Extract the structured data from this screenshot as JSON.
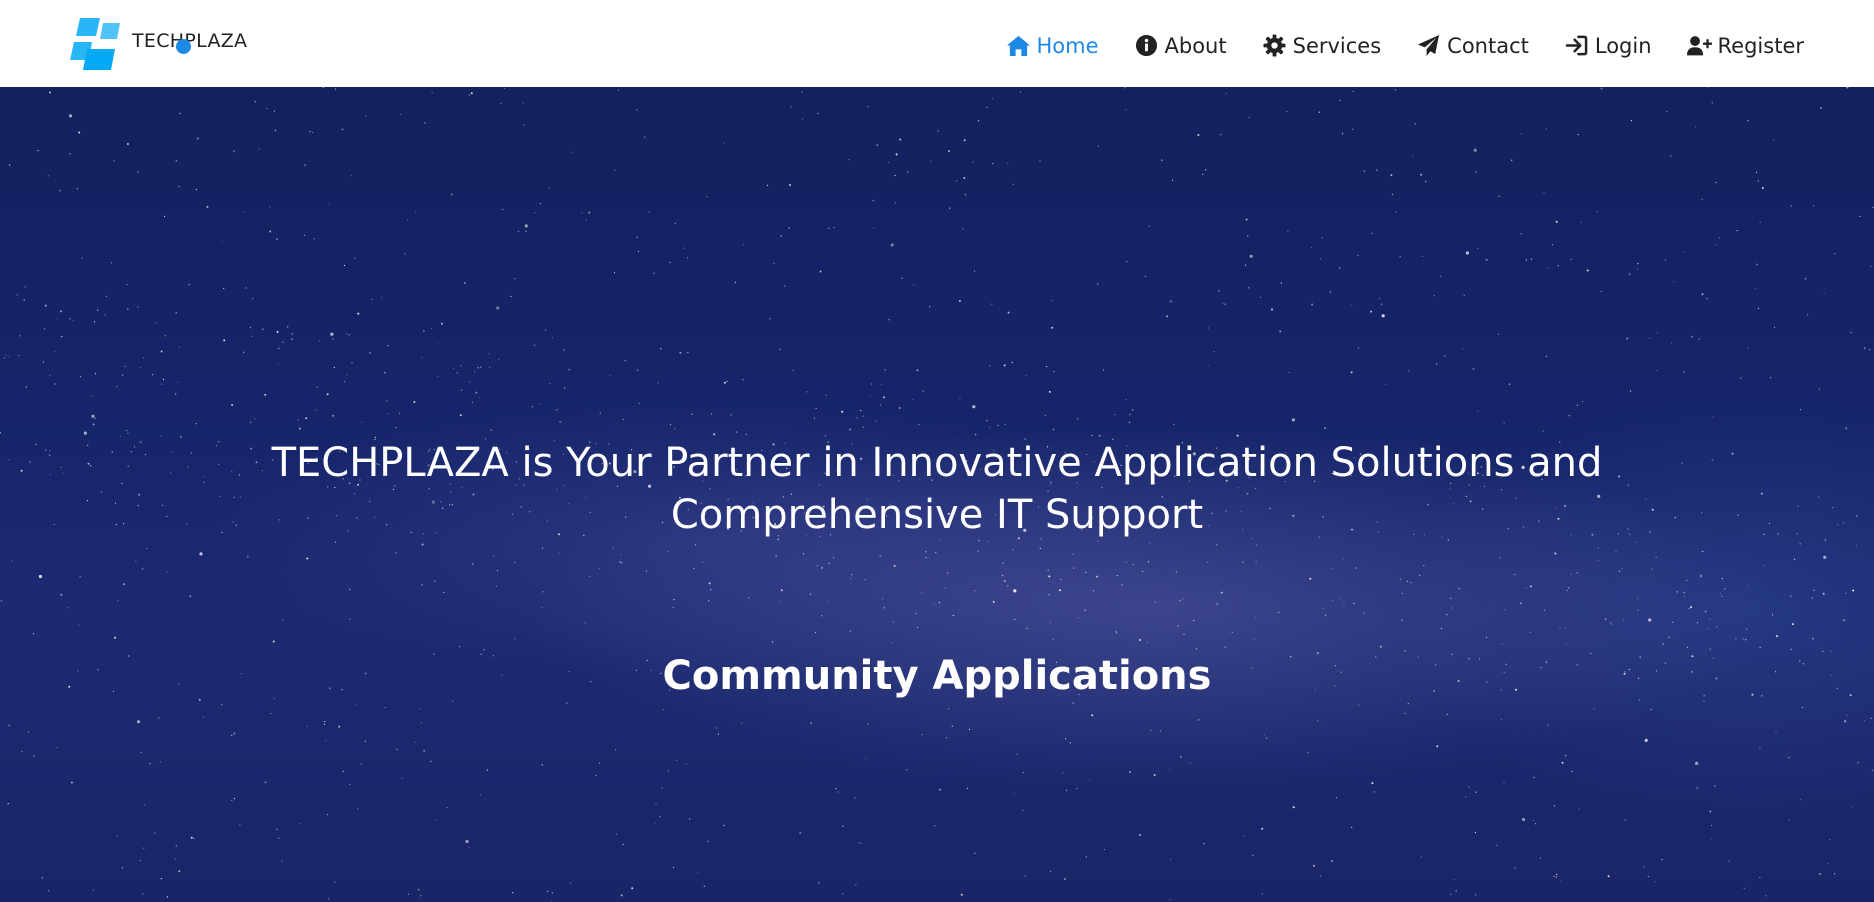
{
  "brand": {
    "name": "TECHPLAZA",
    "logo_icon": "techplaza-logo-icon",
    "accent_color": "#1e88e5",
    "logo_color": "#29b6f6"
  },
  "nav": {
    "items": [
      {
        "label": "Home",
        "icon": "home-icon",
        "active": true
      },
      {
        "label": "About",
        "icon": "info-icon",
        "active": false
      },
      {
        "label": "Services",
        "icon": "gear-icon",
        "active": false
      },
      {
        "label": "Contact",
        "icon": "paper-plane-icon",
        "active": false
      },
      {
        "label": "Login",
        "icon": "sign-in-icon",
        "active": false
      },
      {
        "label": "Register",
        "icon": "user-plus-icon",
        "active": false
      }
    ],
    "active_color": "#1e88e5",
    "text_color": "#222222"
  },
  "hero": {
    "title": "TECHPLAZA is Your Partner in Innovative Application Solutions and Comprehensive IT Support",
    "subtitle": "Community Applications",
    "background": "starry-night-sky"
  }
}
